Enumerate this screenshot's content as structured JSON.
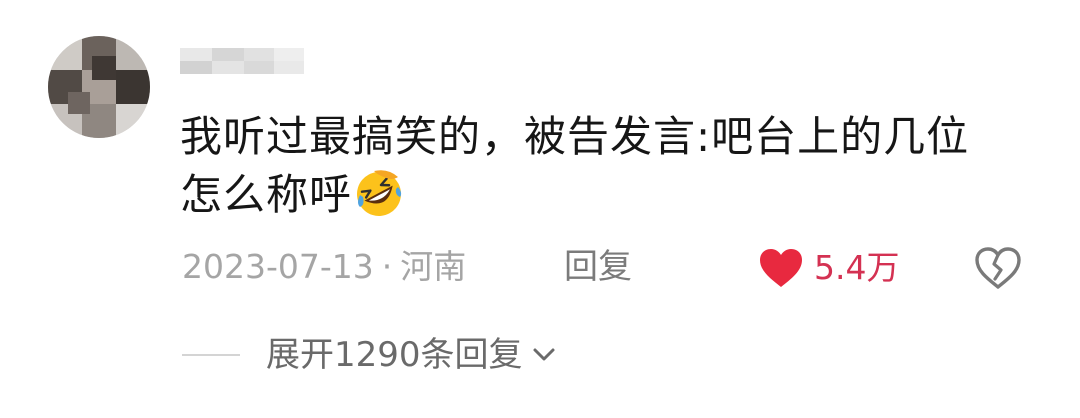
{
  "comment": {
    "text_line1": "我听过最搞笑的，被告发言:吧台上的几位",
    "text_line2": "怎么称呼",
    "emoji": "rolling-on-floor-laughing-emoji",
    "date": "2023-07-13",
    "separator": "·",
    "location": "河南",
    "reply_label": "回复",
    "like_count": "5.4万",
    "like_color": "#e8293f",
    "expand_label": "展开1290条回复"
  }
}
